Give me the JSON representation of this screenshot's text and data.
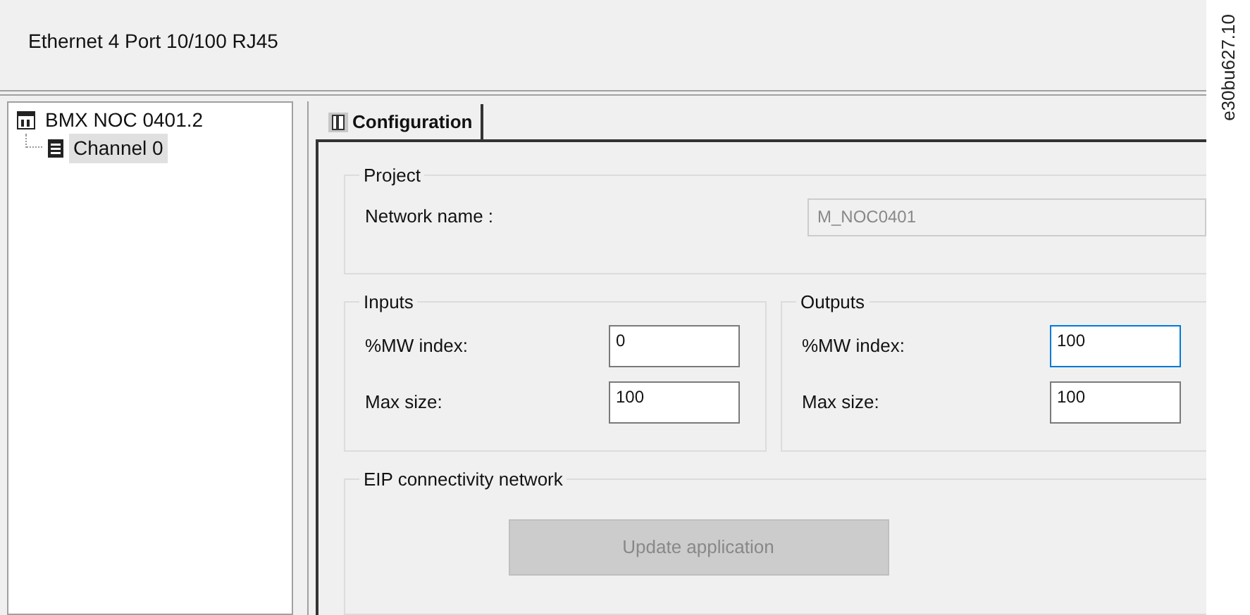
{
  "header": {
    "title": "Ethernet 4 Port 10/100 RJ45"
  },
  "tree": [
    {
      "label": "BMX NOC 0401.2",
      "selected": false,
      "children": [
        {
          "label": "Channel 0",
          "selected": true
        }
      ]
    }
  ],
  "tabs": [
    {
      "label": "Configuration",
      "selected": true
    }
  ],
  "project": {
    "title": "Project",
    "network_name": {
      "label": "Network name :",
      "value": "M_NOC0401",
      "disabled": true
    }
  },
  "groups": [
    {
      "title": "Inputs",
      "fields": [
        {
          "label": "%MW index:",
          "value": "0",
          "focused": false
        },
        {
          "label": "Max size:",
          "value": "100",
          "focused": false
        }
      ]
    },
    {
      "title": "Outputs",
      "fields": [
        {
          "label": "%MW index:",
          "value": "100",
          "focused": true
        },
        {
          "label": "Max size:",
          "value": "100",
          "focused": false
        }
      ]
    }
  ],
  "eip": {
    "title": "EIP connectivity network",
    "button": {
      "label": "Update application",
      "disabled": true
    }
  },
  "figure_id": "e30bu627.10"
}
